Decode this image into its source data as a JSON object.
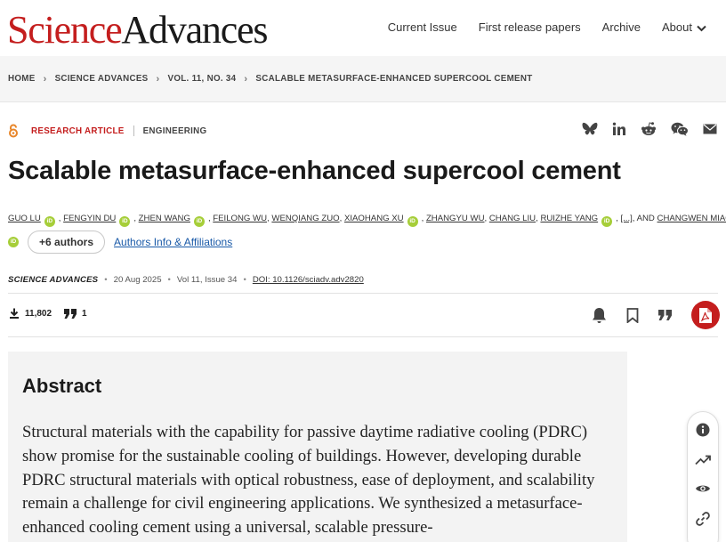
{
  "header": {
    "logo_science": "Science",
    "logo_advances": "Advances",
    "nav": [
      "Current Issue",
      "First release papers",
      "Archive",
      "About"
    ]
  },
  "breadcrumb": [
    "HOME",
    "SCIENCE ADVANCES",
    "VOL. 11, NO. 34",
    "SCALABLE METASURFACE-ENHANCED SUPERCOOL CEMENT"
  ],
  "article": {
    "type": "RESEARCH ARTICLE",
    "category": "ENGINEERING",
    "title": "Scalable metasurface-enhanced supercool cement",
    "authors": [
      "GUO LU",
      "FENGYIN DU",
      "ZHEN WANG",
      "FEILONG WU",
      "WENQIANG ZUO",
      "XIAOHANG XU",
      "ZHANGYU WU",
      "CHANG LIU",
      "RUIZHE YANG",
      "CHANGWEN MIAO"
    ],
    "ellipsis": "[...]",
    "and_text": "AND",
    "more_authors": "+6 authors",
    "affiliations_link": "Authors Info & Affiliations",
    "journal": "SCIENCE ADVANCES",
    "date": "20 Aug 2025",
    "volume": "Vol 11, Issue 34",
    "doi": "DOI: 10.1126/sciadv.adv2820",
    "downloads": "11,802",
    "citations": "1"
  },
  "abstract": {
    "heading": "Abstract",
    "text": "Structural materials with the capability for passive daytime radiative cooling (PDRC) show promise for the sustainable cooling of buildings. However, developing durable PDRC structural materials with optical robustness, ease of deployment, and scalability remain a challenge for civil engineering applications. We synthesized a metasurface-enhanced cooling cement using a universal, scalable pressure-"
  },
  "icons": {
    "share": [
      "bluesky-icon",
      "linkedin-icon",
      "reddit-icon",
      "wechat-icon",
      "email-icon"
    ],
    "actions": [
      "bell-icon",
      "bookmark-icon",
      "quote-icon",
      "pdf-icon"
    ],
    "float": [
      "info-icon",
      "trending-icon",
      "eye-icon",
      "link-icon"
    ]
  },
  "colors": {
    "brand_red": "#c41e1e",
    "orcid_green": "#a6ce39",
    "link_blue": "#1a5aa8",
    "abstract_bg": "#f3f3f3"
  }
}
